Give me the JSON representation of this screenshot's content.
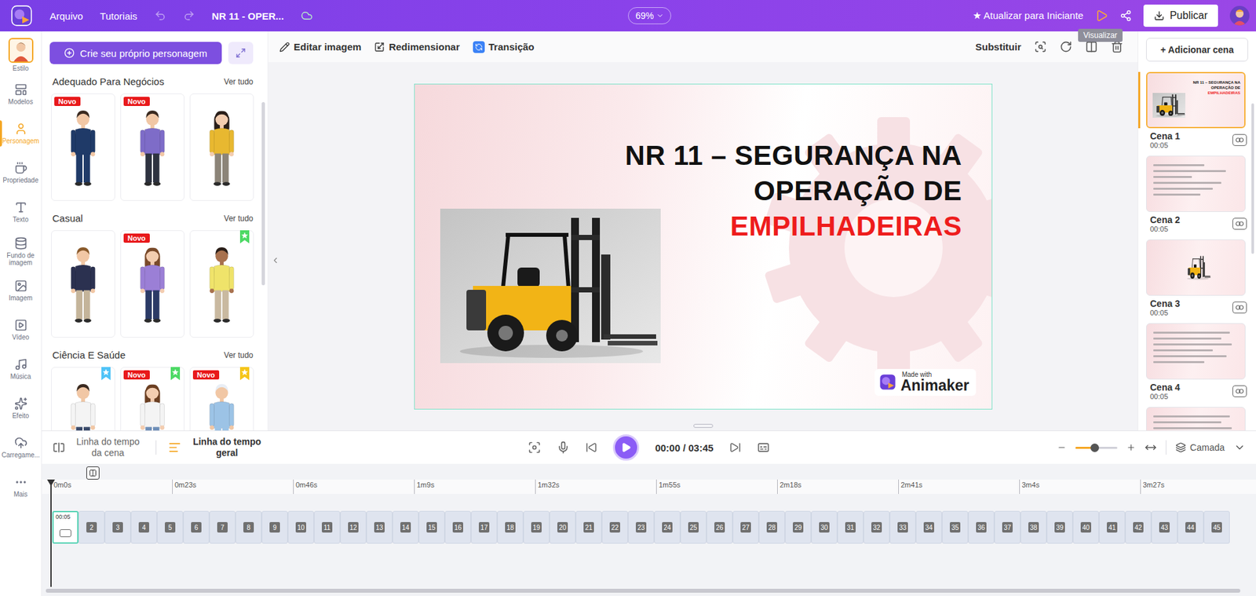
{
  "topbar": {
    "menu": [
      "Arquivo",
      "Tutoriais"
    ],
    "project_title": "NR 11 - OPER...",
    "zoom": "69%",
    "upgrade": "★ Atualizar para Iniciante",
    "publish": "Publicar",
    "tooltip": "Visualizar"
  },
  "rail": [
    {
      "label": "Estilo",
      "selected": false,
      "kind": "avatar"
    },
    {
      "label": "Modelos",
      "selected": false,
      "kind": "icon"
    },
    {
      "label": "Personagem",
      "selected": true,
      "kind": "icon"
    },
    {
      "label": "Propriedade",
      "selected": false,
      "kind": "icon"
    },
    {
      "label": "Texto",
      "selected": false,
      "kind": "icon"
    },
    {
      "label": "Fundo de imagem",
      "selected": false,
      "kind": "icon"
    },
    {
      "label": "Imagem",
      "selected": false,
      "kind": "icon"
    },
    {
      "label": "Vídeo",
      "selected": false,
      "kind": "icon"
    },
    {
      "label": "Música",
      "selected": false,
      "kind": "icon"
    },
    {
      "label": "Efeito",
      "selected": false,
      "kind": "icon"
    },
    {
      "label": "Carregame...",
      "selected": false,
      "kind": "icon"
    },
    {
      "label": "Mais",
      "selected": false,
      "kind": "icon"
    }
  ],
  "characters_panel": {
    "create_button": "Crie seu próprio personagem",
    "sections": [
      {
        "title": "Adequado Para Negócios",
        "see_all": "Ver tudo",
        "items": [
          {
            "kind": "man",
            "badge": "Novo",
            "hair_color": "#3a2a20",
            "skin_color": "#f1c7a5",
            "top_color": "#1f3a68",
            "bottom_color": "#1f3a68"
          },
          {
            "kind": "man",
            "badge": "Novo",
            "hair_color": "#3a2a20",
            "skin_color": "#f1c7a5",
            "top_color": "#7e6cc8",
            "bottom_color": "#2e3340"
          },
          {
            "kind": "woman",
            "hair_color": "#2a1f1a",
            "skin_color": "#f3cdb0",
            "top_color": "#e8b830",
            "bottom_color": "#8c8478"
          }
        ]
      },
      {
        "title": "Casual",
        "see_all": "Ver tudo",
        "items": [
          {
            "kind": "man",
            "hair_color": "#8a5a2b",
            "skin_color": "#f1c7a5",
            "top_color": "#2b3150",
            "bottom_color": "#c4b49a"
          },
          {
            "kind": "woman",
            "badge": "Novo",
            "hair_color": "#7a4a2a",
            "skin_color": "#f3cdb0",
            "top_color": "#9b7fd6",
            "bottom_color": "#2b3a66"
          },
          {
            "kind": "man",
            "flag_color": "#4cd964",
            "hair_color": "#2a1e18",
            "skin_color": "#a8714e",
            "top_color": "#efe36a",
            "bottom_color": "#c9b9a0"
          }
        ]
      },
      {
        "title": "Ciência E Saúde",
        "see_all": "Ver tudo",
        "items": [
          {
            "kind": "man",
            "flag_color": "#4fc3f7",
            "hair_color": "#3a2a20",
            "skin_color": "#f1c7a5",
            "top_color": "#f4f4f4",
            "bottom_color": "#3a4a6a"
          },
          {
            "kind": "woman",
            "badge": "Novo",
            "flag_color": "#4cd964",
            "hair_color": "#6b3f22",
            "skin_color": "#f3cdb0",
            "top_color": "#f4f4f4",
            "bottom_color": "#6f8fb8"
          },
          {
            "kind": "man",
            "badge": "Novo",
            "flag_color": "#f5c518",
            "hair_color": "#e9eef5",
            "skin_color": "#f1c7a5",
            "top_color": "#9cc3e6",
            "bottom_color": "#9cc3e6"
          }
        ]
      }
    ]
  },
  "toolbar": {
    "items": [
      "Editar imagem",
      "Redimensionar",
      "Transição"
    ],
    "replace": "Substituir"
  },
  "slide": {
    "title_lines": [
      {
        "text": "NR 11 – SEGURANÇA NA",
        "color": "#111111"
      },
      {
        "text": "OPERAÇÃO DE",
        "color": "#111111"
      },
      {
        "text": "EMPILHADEIRAS",
        "color": "#ee1c1c"
      }
    ],
    "watermark": {
      "small": "Made with",
      "brand": "Animaker"
    }
  },
  "scenes_panel": {
    "add_button": "+ Adicionar cena",
    "scenes": [
      {
        "name": "Cena 1",
        "time": "00:05",
        "selected": true,
        "kind": "title"
      },
      {
        "name": "Cena 2",
        "time": "00:05",
        "selected": false,
        "kind": "table"
      },
      {
        "name": "Cena 3",
        "time": "00:05",
        "selected": false,
        "kind": "image"
      },
      {
        "name": "Cena 4",
        "time": "00:05",
        "selected": false,
        "kind": "text"
      },
      {
        "selected": false,
        "kind": "text"
      }
    ]
  },
  "timeline": {
    "tabs": [
      {
        "label": "Linha do tempo da cena",
        "selected": false
      },
      {
        "label": "Linha do tempo geral",
        "selected": true
      }
    ],
    "time": "00:00 / 03:45",
    "zoom_level": 0.45,
    "layer": "Camada",
    "ruler": [
      "0m0s",
      "0m23s",
      "0m46s",
      "1m9s",
      "1m32s",
      "1m55s",
      "2m18s",
      "2m41s",
      "3m4s",
      "3m27s"
    ],
    "track": [
      {
        "label": "00:05",
        "selected": true
      },
      {
        "label": "2",
        "selected": false
      },
      {
        "label": "3",
        "selected": false
      },
      {
        "label": "4",
        "selected": false
      },
      {
        "label": "5",
        "selected": false
      },
      {
        "label": "6",
        "selected": false
      },
      {
        "label": "7",
        "selected": false
      },
      {
        "label": "8",
        "selected": false
      },
      {
        "label": "9",
        "selected": false
      },
      {
        "label": "10",
        "selected": false
      },
      {
        "label": "11",
        "selected": false
      },
      {
        "label": "12",
        "selected": false
      },
      {
        "label": "13",
        "selected": false
      },
      {
        "label": "14",
        "selected": false
      },
      {
        "label": "15",
        "selected": false
      },
      {
        "label": "16",
        "selected": false
      },
      {
        "label": "17",
        "selected": false
      },
      {
        "label": "18",
        "selected": false
      },
      {
        "label": "19",
        "selected": false
      },
      {
        "label": "20",
        "selected": false
      },
      {
        "label": "21",
        "selected": false
      },
      {
        "label": "22",
        "selected": false
      },
      {
        "label": "23",
        "selected": false
      },
      {
        "label": "24",
        "selected": false
      },
      {
        "label": "25",
        "selected": false
      },
      {
        "label": "26",
        "selected": false
      },
      {
        "label": "27",
        "selected": false
      },
      {
        "label": "28",
        "selected": false
      },
      {
        "label": "29",
        "selected": false
      },
      {
        "label": "30",
        "selected": false
      },
      {
        "label": "31",
        "selected": false
      },
      {
        "label": "32",
        "selected": false
      },
      {
        "label": "33",
        "selected": false
      },
      {
        "label": "34",
        "selected": false
      },
      {
        "label": "35",
        "selected": false
      },
      {
        "label": "36",
        "selected": false
      },
      {
        "label": "37",
        "selected": false
      },
      {
        "label": "38",
        "selected": false
      },
      {
        "label": "39",
        "selected": false
      },
      {
        "label": "40",
        "selected": false
      },
      {
        "label": "41",
        "selected": false
      },
      {
        "label": "42",
        "selected": false
      },
      {
        "label": "43",
        "selected": false
      },
      {
        "label": "44",
        "selected": false
      },
      {
        "label": "45",
        "selected": false
      }
    ]
  }
}
